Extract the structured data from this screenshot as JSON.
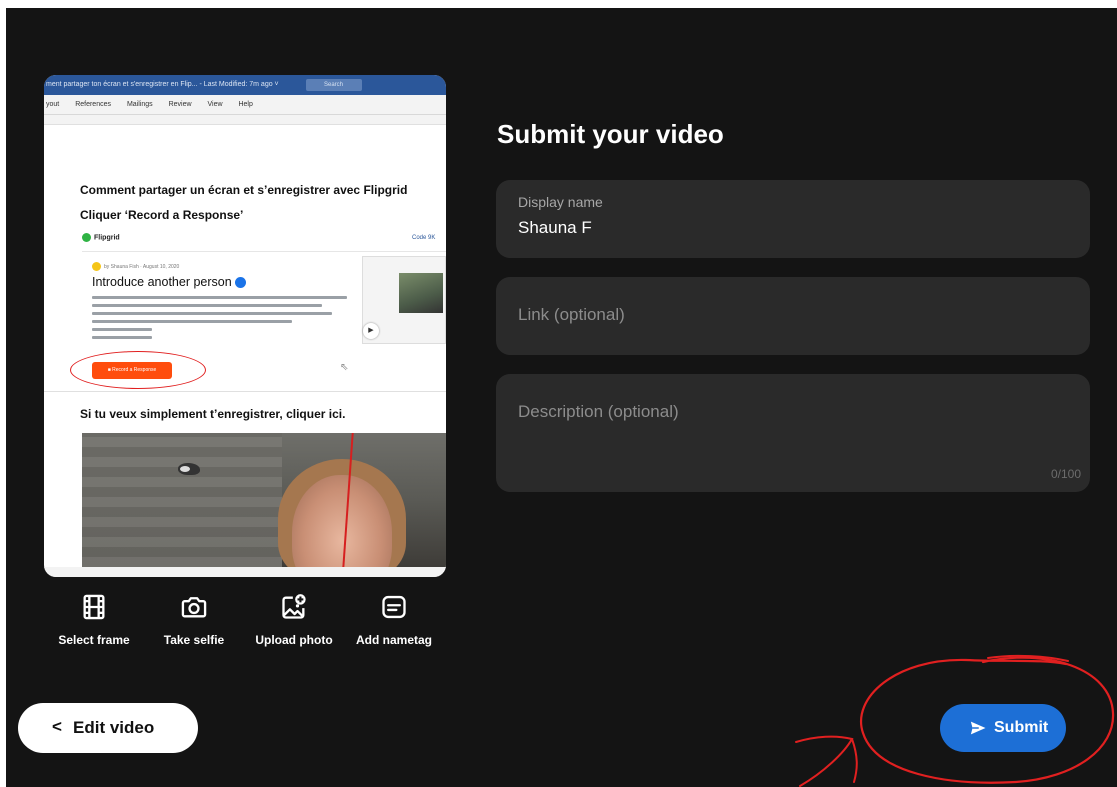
{
  "preview": {
    "titlebar": "ment partager ton écran et s'enregistrer en Flip...  -  Last Modified: 7m ago ˅",
    "search": "Search",
    "ribbon_tabs": [
      "yout",
      "References",
      "Mailings",
      "Review",
      "View",
      "Help"
    ],
    "heading_1": "Comment partager un écran et s’enregistrer avec Flipgrid",
    "heading_2": "Cliquer ‘Record a Response’",
    "logo_text": "Flipgrid",
    "code_link": "Code 9K",
    "byline": "by Shauna Fish · August 10, 2020",
    "card_title": "Introduce another person",
    "record_button": "Record a Response",
    "heading_3": "Si tu veux simplement t’enregistrer, cliquer ici."
  },
  "tools": [
    {
      "label": "Select frame",
      "icon": "film-strip-icon"
    },
    {
      "label": "Take selfie",
      "icon": "camera-icon"
    },
    {
      "label": "Upload photo",
      "icon": "image-add-icon"
    },
    {
      "label": "Add nametag",
      "icon": "nametag-icon"
    }
  ],
  "form": {
    "title": "Submit your video",
    "display_name": {
      "label": "Display name",
      "value": "Shauna F"
    },
    "link": {
      "placeholder": "Link (optional)"
    },
    "description": {
      "placeholder": "Description (optional)",
      "counter": "0/100"
    }
  },
  "buttons": {
    "edit": "Edit video",
    "submit": "Submit"
  },
  "colors": {
    "background": "#141414",
    "field": "#2a2a2a",
    "accent": "#1d6fd6",
    "annotation": "#e12020"
  }
}
